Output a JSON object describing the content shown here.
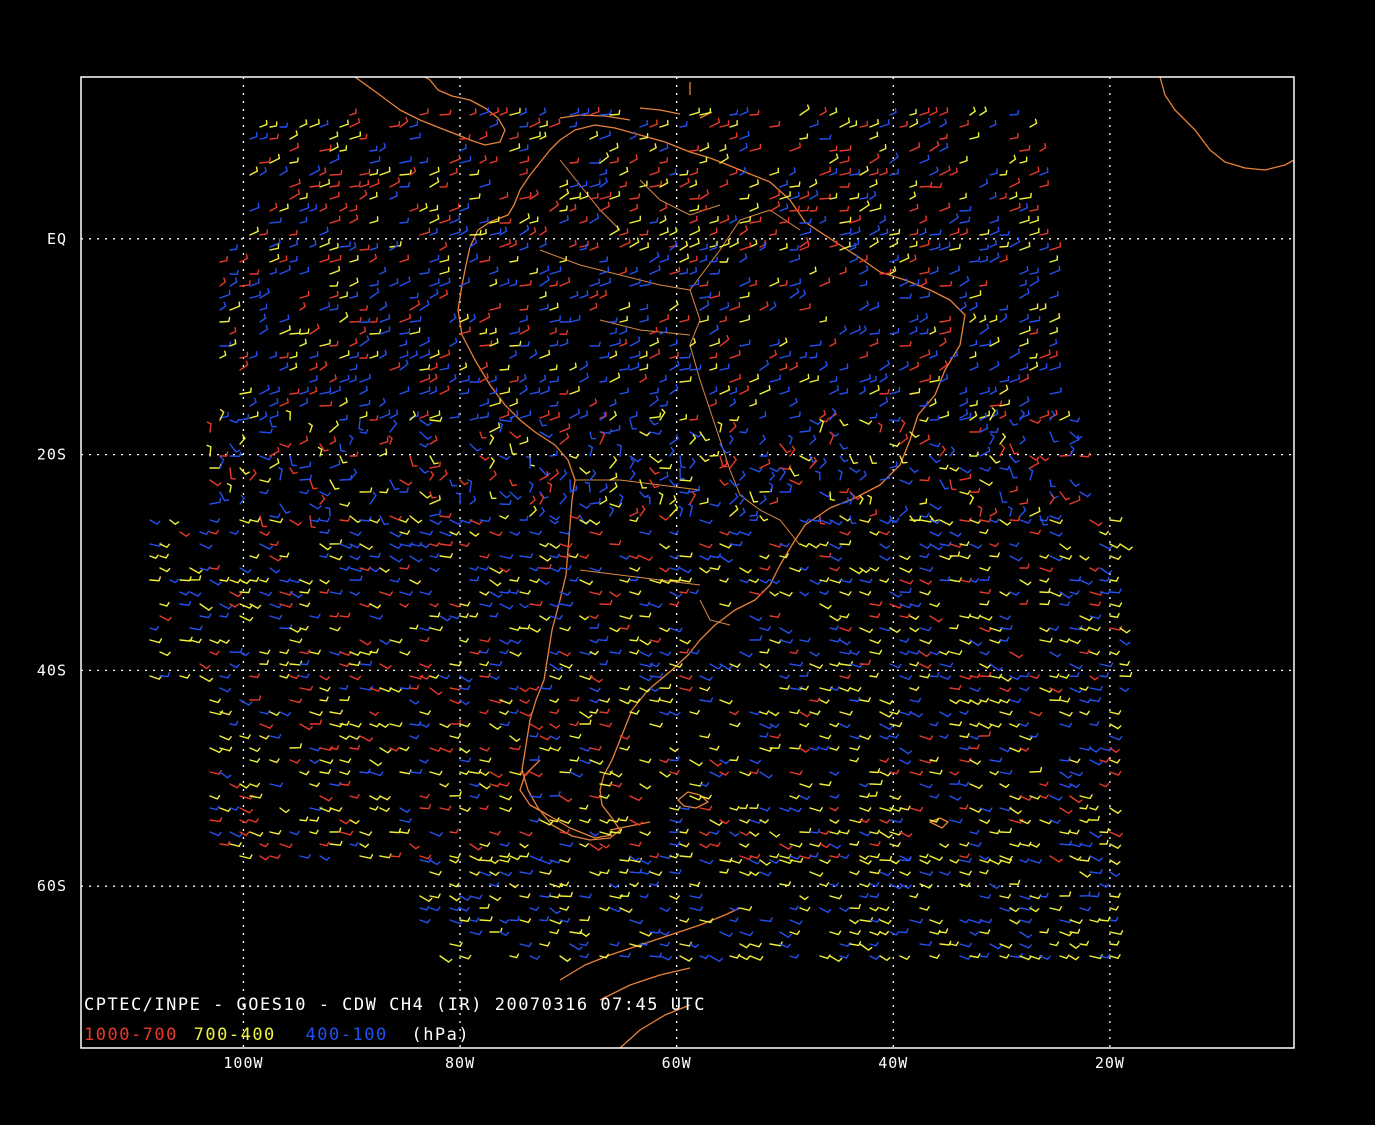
{
  "map": {
    "lon_range": [
      -115,
      -3
    ],
    "lat_range": [
      15,
      -75
    ],
    "frame_color": "#ffffff",
    "coast_color": "#e8823a",
    "background": "#000000",
    "x_ticks": [
      {
        "lon": -100,
        "label": "100W"
      },
      {
        "lon": -80,
        "label": "80W"
      },
      {
        "lon": -60,
        "label": "60W"
      },
      {
        "lon": -40,
        "label": "40W"
      },
      {
        "lon": -20,
        "label": "20W"
      }
    ],
    "y_ticks": [
      {
        "lat": 0,
        "label": "EQ"
      },
      {
        "lat": -20,
        "label": "20S"
      },
      {
        "lat": -40,
        "label": "40S"
      },
      {
        "lat": -60,
        "label": "60S"
      }
    ]
  },
  "caption": {
    "title": "CPTEC/INPE - GOES10 - CDW CH4 (IR) 20070316 07:45 UTC",
    "legend": [
      {
        "text": "1000-700",
        "color": "#e8392b"
      },
      {
        "text": "700-400",
        "color": "#f2f23a"
      },
      {
        "text": "400-100",
        "color": "#2450f0"
      },
      {
        "text": "(hPa)",
        "color": "#ffffff"
      }
    ]
  },
  "wind_layers": [
    {
      "name": "1000-700",
      "color": "#e8392b"
    },
    {
      "name": "700-400",
      "color": "#f2f23a"
    },
    {
      "name": "400-100",
      "color": "#2450f0"
    }
  ]
}
